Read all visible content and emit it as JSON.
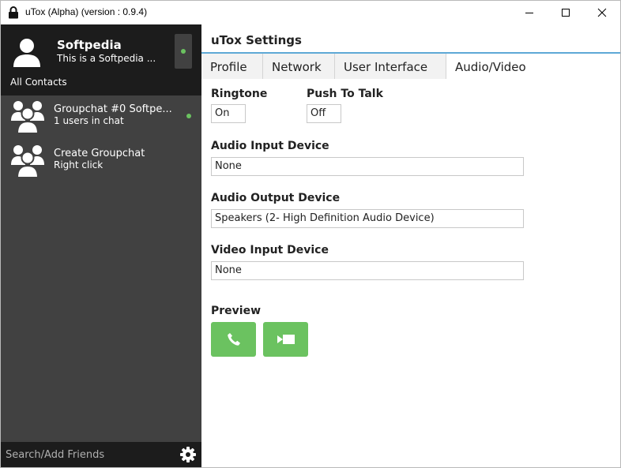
{
  "window": {
    "title": "uTox (Alpha) (version : 0.9.4)"
  },
  "self": {
    "name": "Softpedia",
    "status_message": "This is a Softpedia ...",
    "status_color": "#6bc260"
  },
  "sidebar": {
    "filter_label": "All Contacts",
    "contacts": [
      {
        "name": "Groupchat #0 Softpe...",
        "subtitle": "1 users in chat"
      },
      {
        "name": "Create Groupchat",
        "subtitle": "Right click"
      }
    ],
    "search_placeholder": "Search/Add Friends"
  },
  "settings": {
    "heading": "uTox Settings",
    "tabs": [
      "Profile",
      "Network",
      "User Interface",
      "Audio/Video"
    ],
    "selected_tab": "Audio/Video",
    "ringtone": {
      "label": "Ringtone",
      "value": "On"
    },
    "push_to_talk": {
      "label": "Push To Talk",
      "value": "Off"
    },
    "audio_input": {
      "label": "Audio Input Device",
      "value": "None"
    },
    "audio_output": {
      "label": "Audio Output Device",
      "value": "Speakers (2- High Definition Audio Device)"
    },
    "video_input": {
      "label": "Video Input Device",
      "value": "None"
    },
    "preview_label": "Preview"
  },
  "colors": {
    "accent_green": "#6bc260",
    "sidebar_dark": "#1c1c1c",
    "sidebar_mid": "#414141",
    "tab_underline": "#5ea8d6"
  },
  "icons": {
    "app": "lock-icon",
    "minimize": "minimize-icon",
    "maximize": "maximize-icon",
    "close": "close-icon",
    "avatar": "user-avatar-icon",
    "group": "group-icon",
    "settings": "gear-icon",
    "call": "phone-icon",
    "video": "video-camera-icon"
  }
}
